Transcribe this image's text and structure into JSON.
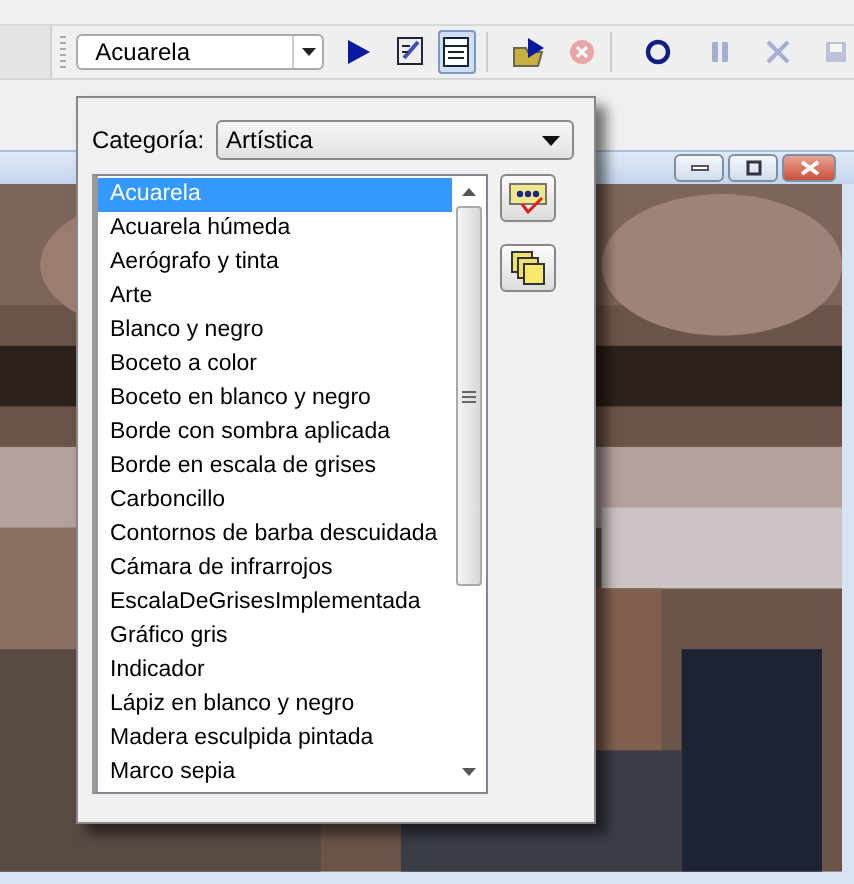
{
  "toolbar": {
    "preset_combo": {
      "value": "Acuarela"
    },
    "buttons": [
      {
        "kind": "play",
        "disabled": false,
        "pressed": false
      },
      {
        "kind": "script",
        "disabled": false,
        "pressed": false
      },
      {
        "kind": "list",
        "disabled": false,
        "pressed": true
      },
      {
        "kind": "folder-run",
        "disabled": false,
        "pressed": false
      },
      {
        "kind": "cancel",
        "disabled": true,
        "pressed": false
      },
      {
        "kind": "record",
        "disabled": false,
        "pressed": false
      },
      {
        "kind": "pause",
        "disabled": true,
        "pressed": false
      },
      {
        "kind": "stop",
        "disabled": true,
        "pressed": false
      },
      {
        "kind": "save",
        "disabled": true,
        "pressed": false
      }
    ]
  },
  "image_window": {
    "buttons": [
      {
        "kind": "minimize"
      },
      {
        "kind": "maximize"
      },
      {
        "kind": "close"
      }
    ]
  },
  "preset_popup": {
    "category_label": "Categoría:",
    "category": {
      "value": "Artística"
    },
    "presets": [
      {
        "label": "Acuarela",
        "selected": true
      },
      {
        "label": "Acuarela húmeda",
        "selected": false
      },
      {
        "label": "Aerógrafo y tinta",
        "selected": false
      },
      {
        "label": "Arte",
        "selected": false
      },
      {
        "label": "Blanco y negro",
        "selected": false
      },
      {
        "label": "Boceto a color",
        "selected": false
      },
      {
        "label": "Boceto en blanco y negro",
        "selected": false
      },
      {
        "label": "Borde con sombra aplicada",
        "selected": false
      },
      {
        "label": "Borde en escala de grises",
        "selected": false
      },
      {
        "label": "Carboncillo",
        "selected": false
      },
      {
        "label": "Contornos de barba descuidada",
        "selected": false
      },
      {
        "label": "Cámara de infrarrojos",
        "selected": false
      },
      {
        "label": "EscalaDeGrisesImplementada",
        "selected": false
      },
      {
        "label": "Gráfico gris",
        "selected": false
      },
      {
        "label": "Indicador",
        "selected": false
      },
      {
        "label": "Lápiz en blanco y negro",
        "selected": false
      },
      {
        "label": "Madera esculpida pintada",
        "selected": false
      },
      {
        "label": "Marco sepia",
        "selected": false
      }
    ],
    "side_buttons": [
      {
        "kind": "edit"
      },
      {
        "kind": "copy"
      }
    ]
  }
}
